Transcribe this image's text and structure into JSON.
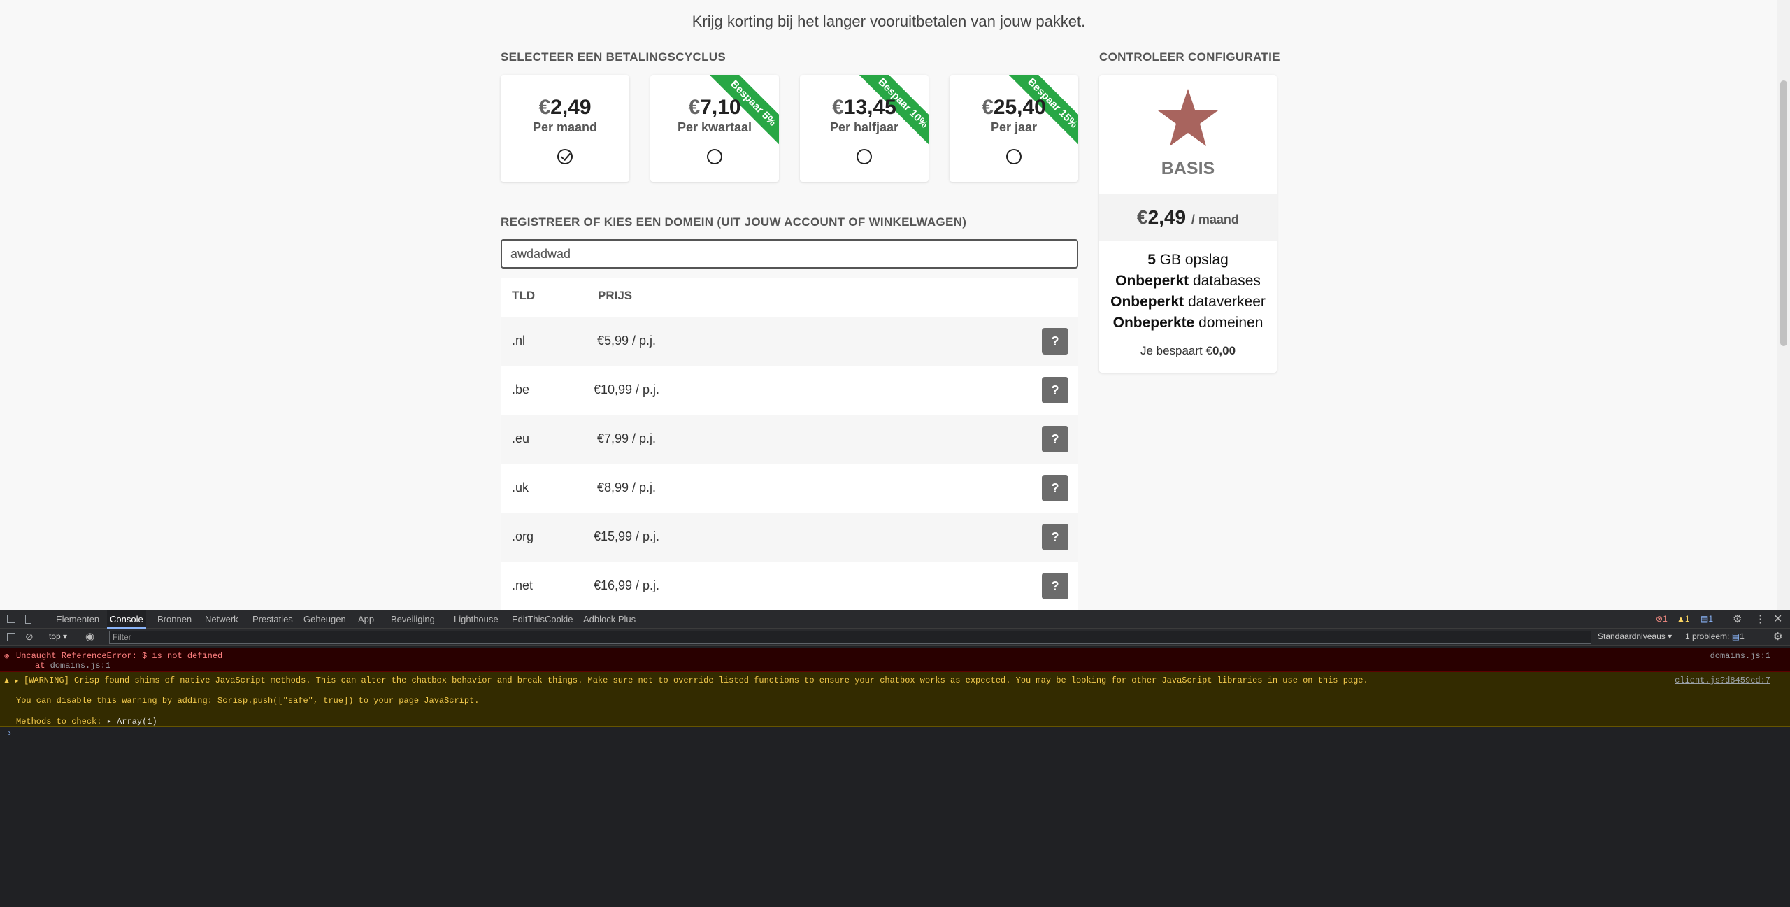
{
  "page": {
    "subtitle": "Krijg korting bij het langer vooruitbetalen van jouw pakket.",
    "cycle_label": "SELECTEER EEN BETALINGSCYCLUS",
    "config_label": "CONTROLEER CONFIGURATIE",
    "domain_label": "REGISTREER OF KIES EEN DOMEIN (UIT JOUW ACCOUNT OF WINKELWAGEN)",
    "domain_input_value": "awdadwad",
    "cycles": [
      {
        "currency": "€",
        "amount": "2,49",
        "period": "Per maand",
        "ribbon": "",
        "selected": true
      },
      {
        "currency": "€",
        "amount": "7,10",
        "period": "Per kwartaal",
        "ribbon": "Bespaar 5%",
        "selected": false
      },
      {
        "currency": "€",
        "amount": "13,45",
        "period": "Per halfjaar",
        "ribbon": "Bespaar 10%",
        "selected": false
      },
      {
        "currency": "€",
        "amount": "25,40",
        "period": "Per jaar",
        "ribbon": "Bespaar 15%",
        "selected": false
      }
    ],
    "table": {
      "col_tld": "TLD",
      "col_price": "PRIJS",
      "rows": [
        {
          "tld": ".nl",
          "price": "€5,99 / p.j.",
          "button": "?"
        },
        {
          "tld": ".be",
          "price": "€10,99 / p.j.",
          "button": "?"
        },
        {
          "tld": ".eu",
          "price": "€7,99 / p.j.",
          "button": "?"
        },
        {
          "tld": ".uk",
          "price": "€8,99 / p.j.",
          "button": "?"
        },
        {
          "tld": ".org",
          "price": "€15,99 / p.j.",
          "button": "?"
        },
        {
          "tld": ".net",
          "price": "€16,99 / p.j.",
          "button": "?"
        }
      ]
    },
    "config": {
      "plan_name": "BASIS",
      "price_currency": "€",
      "price_amount": "2,49",
      "price_period": "/ maand",
      "features": [
        {
          "bold": "5",
          "text": " GB opslag"
        },
        {
          "bold": "Onbeperkt",
          "text": " databases"
        },
        {
          "bold": "Onbeperkt",
          "text": " dataverkeer"
        },
        {
          "bold": "Onbeperkte",
          "text": " domeinen"
        }
      ],
      "savings_prefix": "Je bespaart €",
      "savings_value": "0,00",
      "star_color": "#a8645e"
    }
  },
  "devtools": {
    "tabs": [
      "Elementen",
      "Console",
      "Bronnen",
      "Netwerk",
      "Prestaties",
      "Geheugen",
      "App",
      "Beveiliging",
      "Lighthouse",
      "EditThisCookie",
      "Adblock Plus"
    ],
    "active_tab": "Console",
    "badges": {
      "errors": "1",
      "warnings": "1",
      "messages": "1"
    },
    "context": "top",
    "filter_placeholder": "Filter",
    "levels": "Standaardniveaus",
    "issues": "1 probleem:",
    "issues_count": "1",
    "error": {
      "message": "Uncaught ReferenceError: $ is not defined",
      "at_prefix": "at ",
      "at_link": "domains.js:1",
      "source": "domains.js:1"
    },
    "warning": {
      "message": "[WARNING] Crisp found shims of native JavaScript methods. This can alter the chatbox behavior and break things. Make sure not to override listed functions to ensure your chatbox works as expected. You may be looking for other JavaScript libraries in use on this page.",
      "hint": "You can disable this warning by adding: $crisp.push([\"safe\", true]) to your page JavaScript.",
      "methods_label": "Methods to check:",
      "methods_value": "Array(1)",
      "source": "client.js?d8459ed:7"
    },
    "prompt": "›"
  }
}
